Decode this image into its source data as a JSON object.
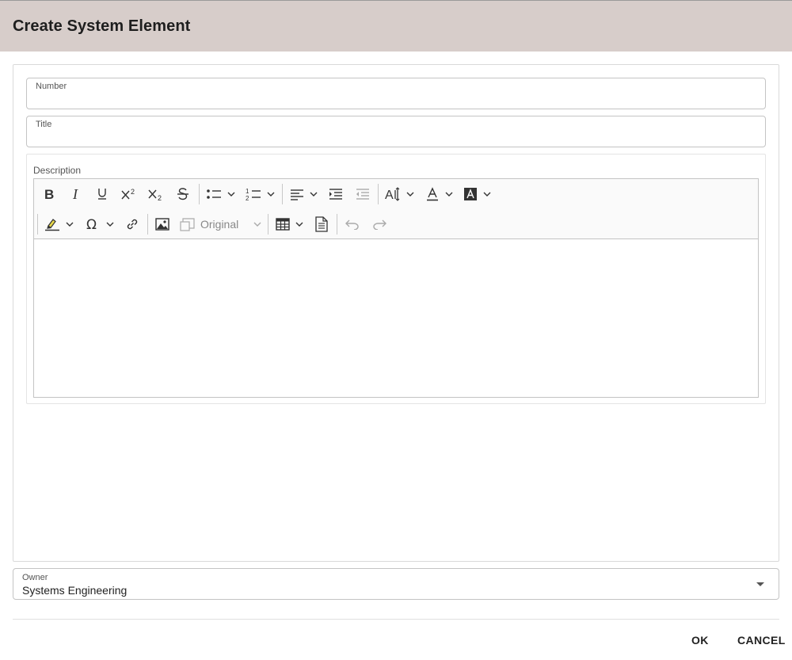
{
  "dialog": {
    "title": "Create System Element"
  },
  "form": {
    "number": {
      "label": "Number",
      "value": ""
    },
    "title": {
      "label": "Title",
      "value": ""
    },
    "description": {
      "label": "Description",
      "toolbar": {
        "image_size_label": "Original",
        "icons": [
          "bold-icon",
          "italic-icon",
          "underline-icon",
          "superscript-icon",
          "subscript-icon",
          "strikethrough-icon",
          "bulleted-list-icon",
          "numbered-list-icon",
          "align-left-icon",
          "indent-icon",
          "outdent-icon",
          "font-size-icon",
          "font-color-icon",
          "font-background-color-icon",
          "highlight-icon",
          "special-characters-icon",
          "link-icon",
          "image-icon",
          "table-icon",
          "source-document-icon",
          "undo-icon",
          "redo-icon"
        ]
      },
      "content": ""
    },
    "owner": {
      "label": "Owner",
      "value": "Systems Engineering"
    }
  },
  "footer": {
    "ok_label": "OK",
    "cancel_label": "CANCEL"
  }
}
